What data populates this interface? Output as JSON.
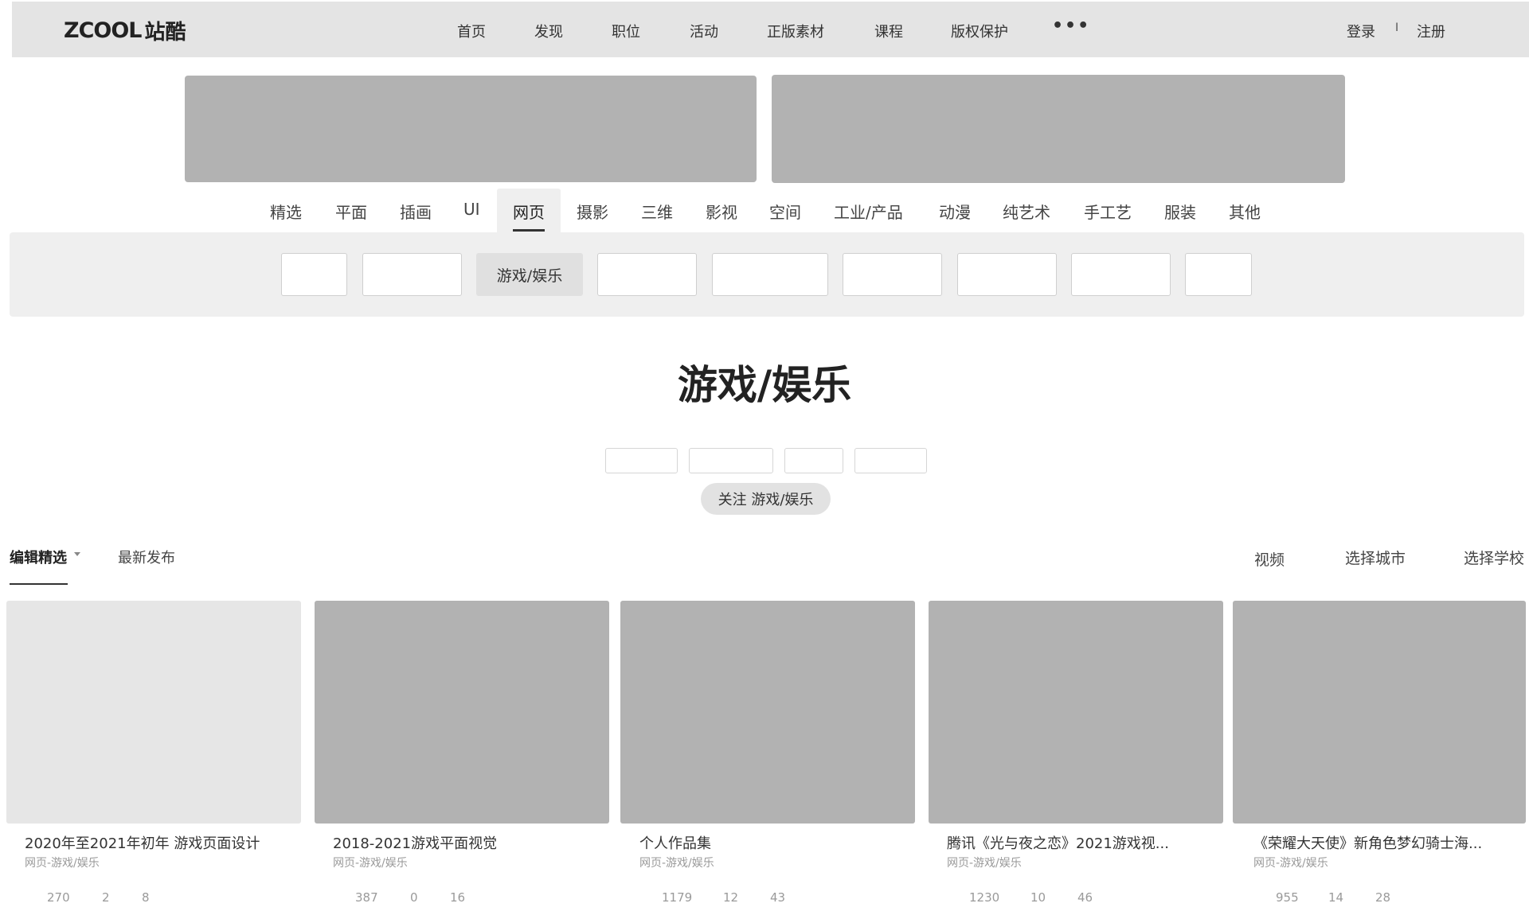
{
  "header": {
    "logo_mark": "ZCOOL",
    "logo_text": "站酷",
    "nav": [
      "首页",
      "发现",
      "职位",
      "活动",
      "正版素材",
      "课程",
      "版权保护"
    ],
    "more": "•••",
    "login": "登录",
    "separator": "I",
    "register": "注册"
  },
  "categories": {
    "tabs": [
      "精选",
      "平面",
      "插画",
      "UI",
      "网页",
      "摄影",
      "三维",
      "影视",
      "空间",
      "工业/产品",
      "动漫",
      "纯艺术",
      "手工艺",
      "服装",
      "其他"
    ],
    "active": "网页"
  },
  "subcategories": {
    "active_label": "游戏/娱乐"
  },
  "topic": {
    "title": "游戏/娱乐",
    "follow_label": "关注 游戏/娱乐"
  },
  "sort": {
    "selected": "编辑精选",
    "latest": "最新发布"
  },
  "filters": {
    "video": "视频",
    "city": "选择城市",
    "school": "选择学校"
  },
  "cards": [
    {
      "title": "2020年至2021年初年 游戏页面设计",
      "category": "网页-游戏/娱乐",
      "views": "270",
      "comments": "2",
      "likes": "8"
    },
    {
      "title": "2018-2021游戏平面视觉",
      "category": "网页-游戏/娱乐",
      "views": "387",
      "comments": "0",
      "likes": "16"
    },
    {
      "title": "个人作品集",
      "category": "网页-游戏/娱乐",
      "views": "1179",
      "comments": "12",
      "likes": "43"
    },
    {
      "title": "腾讯《光与夜之恋》2021游戏视...",
      "category": "网页-游戏/娱乐",
      "views": "1230",
      "comments": "10",
      "likes": "46"
    },
    {
      "title": "《荣耀大天使》新角色梦幻骑士海...",
      "category": "网页-游戏/娱乐",
      "views": "955",
      "comments": "14",
      "likes": "28"
    }
  ],
  "colors": {
    "header_bg": "#e4e4e4",
    "placeholder": "#b2b2b2",
    "subbar_bg": "#efefef"
  }
}
